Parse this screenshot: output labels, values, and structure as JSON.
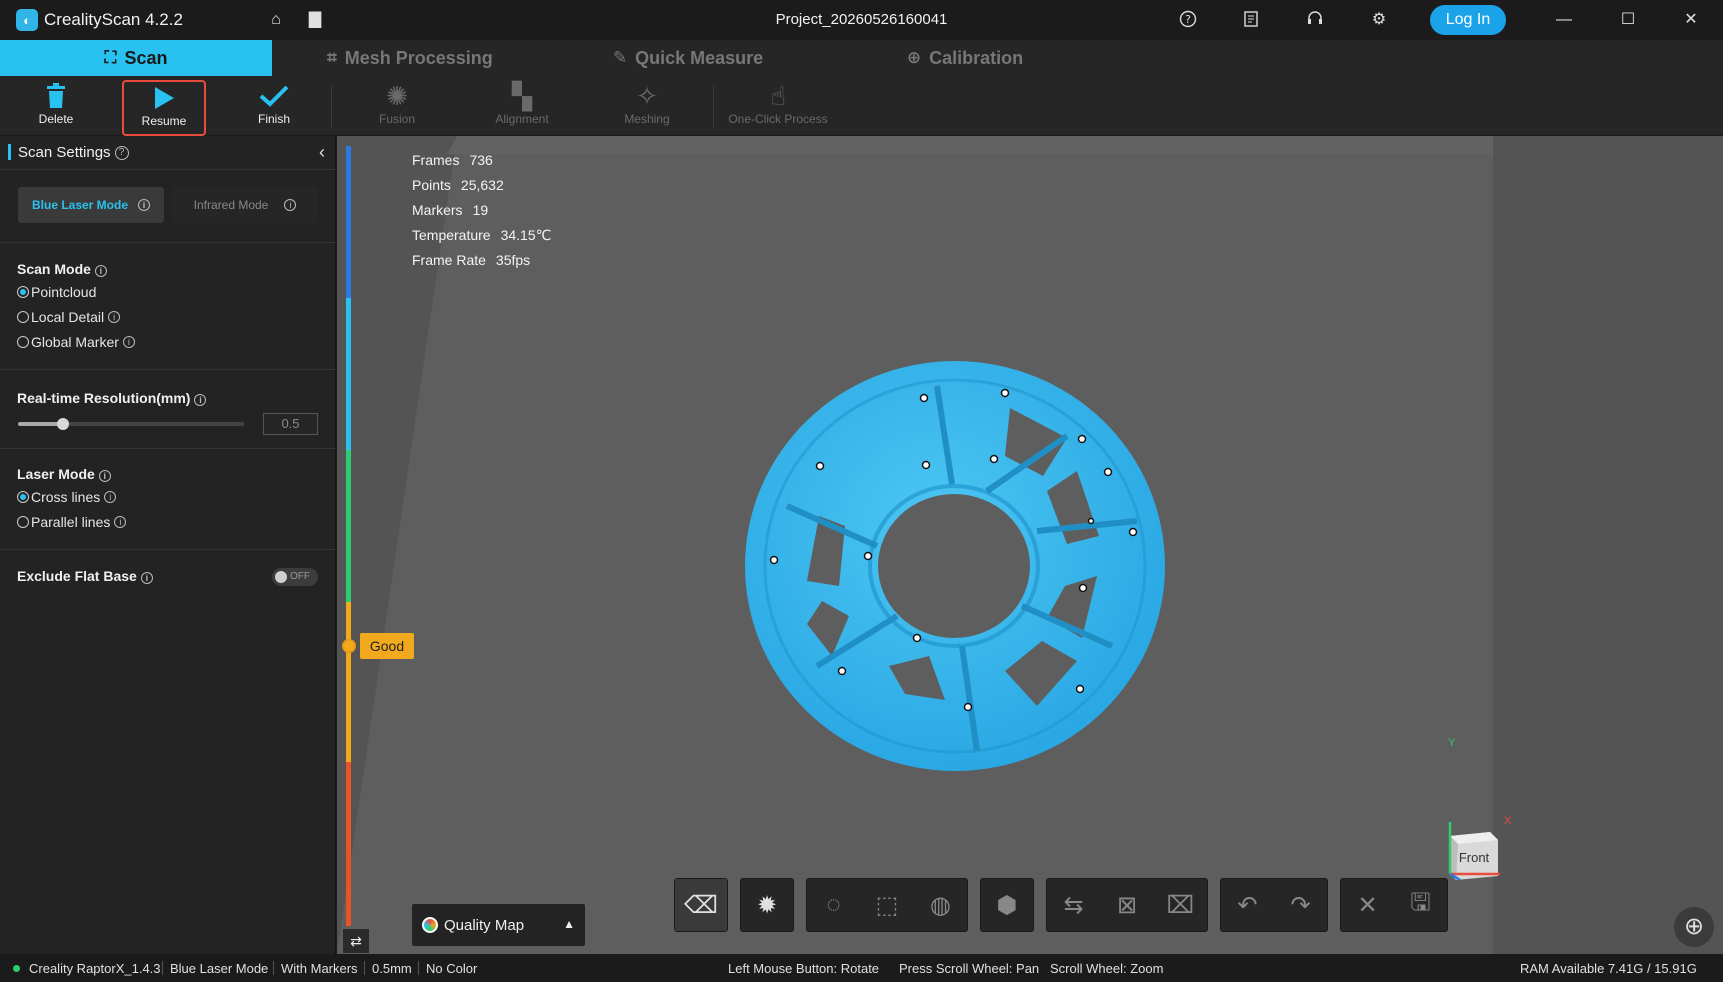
{
  "app": {
    "title": "CrealityScan 4.2.2",
    "project": "Project_20260526160041",
    "login_label": "Log In"
  },
  "tabs": [
    {
      "label": "Scan",
      "icon": "scan-frame-icon"
    },
    {
      "label": "Mesh Processing",
      "icon": "crop-icon"
    },
    {
      "label": "Quick Measure",
      "icon": "ruler-icon"
    },
    {
      "label": "Calibration",
      "icon": "crosshair-icon"
    }
  ],
  "toolbar": [
    {
      "label": "Delete",
      "icon": "trash-icon",
      "enabled": true
    },
    {
      "label": "Resume",
      "icon": "play-icon",
      "enabled": true
    },
    {
      "label": "Finish",
      "icon": "check-icon",
      "enabled": true
    },
    {
      "label": "Fusion",
      "icon": "sparkle-icon",
      "enabled": false
    },
    {
      "label": "Alignment",
      "icon": "alignment-icon",
      "enabled": false
    },
    {
      "label": "Meshing",
      "icon": "meshing-icon",
      "enabled": false
    },
    {
      "label": "One-Click Process",
      "icon": "touch-icon",
      "enabled": false
    }
  ],
  "panel": {
    "title": "Scan Settings",
    "modes": [
      "Blue Laser Mode",
      "Infrared Mode"
    ],
    "scan_mode": {
      "label": "Scan Mode",
      "options": [
        "Pointcloud",
        "Local Detail",
        "Global Marker"
      ],
      "selected": "Pointcloud"
    },
    "resolution": {
      "label": "Real-time Resolution(mm)",
      "value": "0.5",
      "slider_fraction": 0.2
    },
    "laser_mode": {
      "label": "Laser Mode",
      "options": [
        "Cross lines",
        "Parallel lines"
      ],
      "selected": "Cross lines"
    },
    "exclude_flat_base": {
      "label": "Exclude Flat Base",
      "state": "OFF"
    }
  },
  "stats": [
    {
      "label": "Frames",
      "value": "736"
    },
    {
      "label": "Points",
      "value": "25,632"
    },
    {
      "label": "Markers",
      "value": "19"
    },
    {
      "label": "Temperature",
      "value": "34.15℃"
    },
    {
      "label": "Frame Rate",
      "value": "35fps"
    }
  ],
  "quality": {
    "indicator": "Good",
    "map_label": "Quality Map"
  },
  "axes": {
    "cube_face": "Front",
    "x": "X",
    "y": "Y"
  },
  "status": {
    "device": "Creality RaptorX_1.4.3",
    "mode": "Blue Laser Mode",
    "markers": "With Markers",
    "resolution": "0.5mm",
    "color": "No Color",
    "hint_rotate": "Left Mouse Button: Rotate",
    "hint_pan": "Press Scroll Wheel: Pan",
    "hint_zoom": "Scroll Wheel: Zoom",
    "ram": "RAM Available 7.41G / 15.91G"
  },
  "colors": {
    "accent": "#29c1ef",
    "highlight": "#e74c3c",
    "good": "#f2a91e",
    "model": "#34b6ea"
  }
}
